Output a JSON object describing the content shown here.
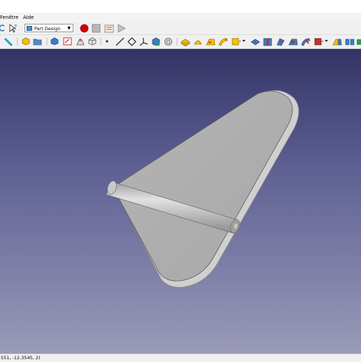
{
  "menu": {
    "window_label": "Fenêtre",
    "help_label": "Aide"
  },
  "toolbar": {
    "workbench_label": "Part Design",
    "record_color": "#d40000"
  },
  "statusbar": {
    "coordinates": "551, -12.3545, 2)"
  },
  "viewport": {
    "background_top": "#333366",
    "background_bottom": "#9a9ab8",
    "model": "fin-with-hinge-pin"
  }
}
